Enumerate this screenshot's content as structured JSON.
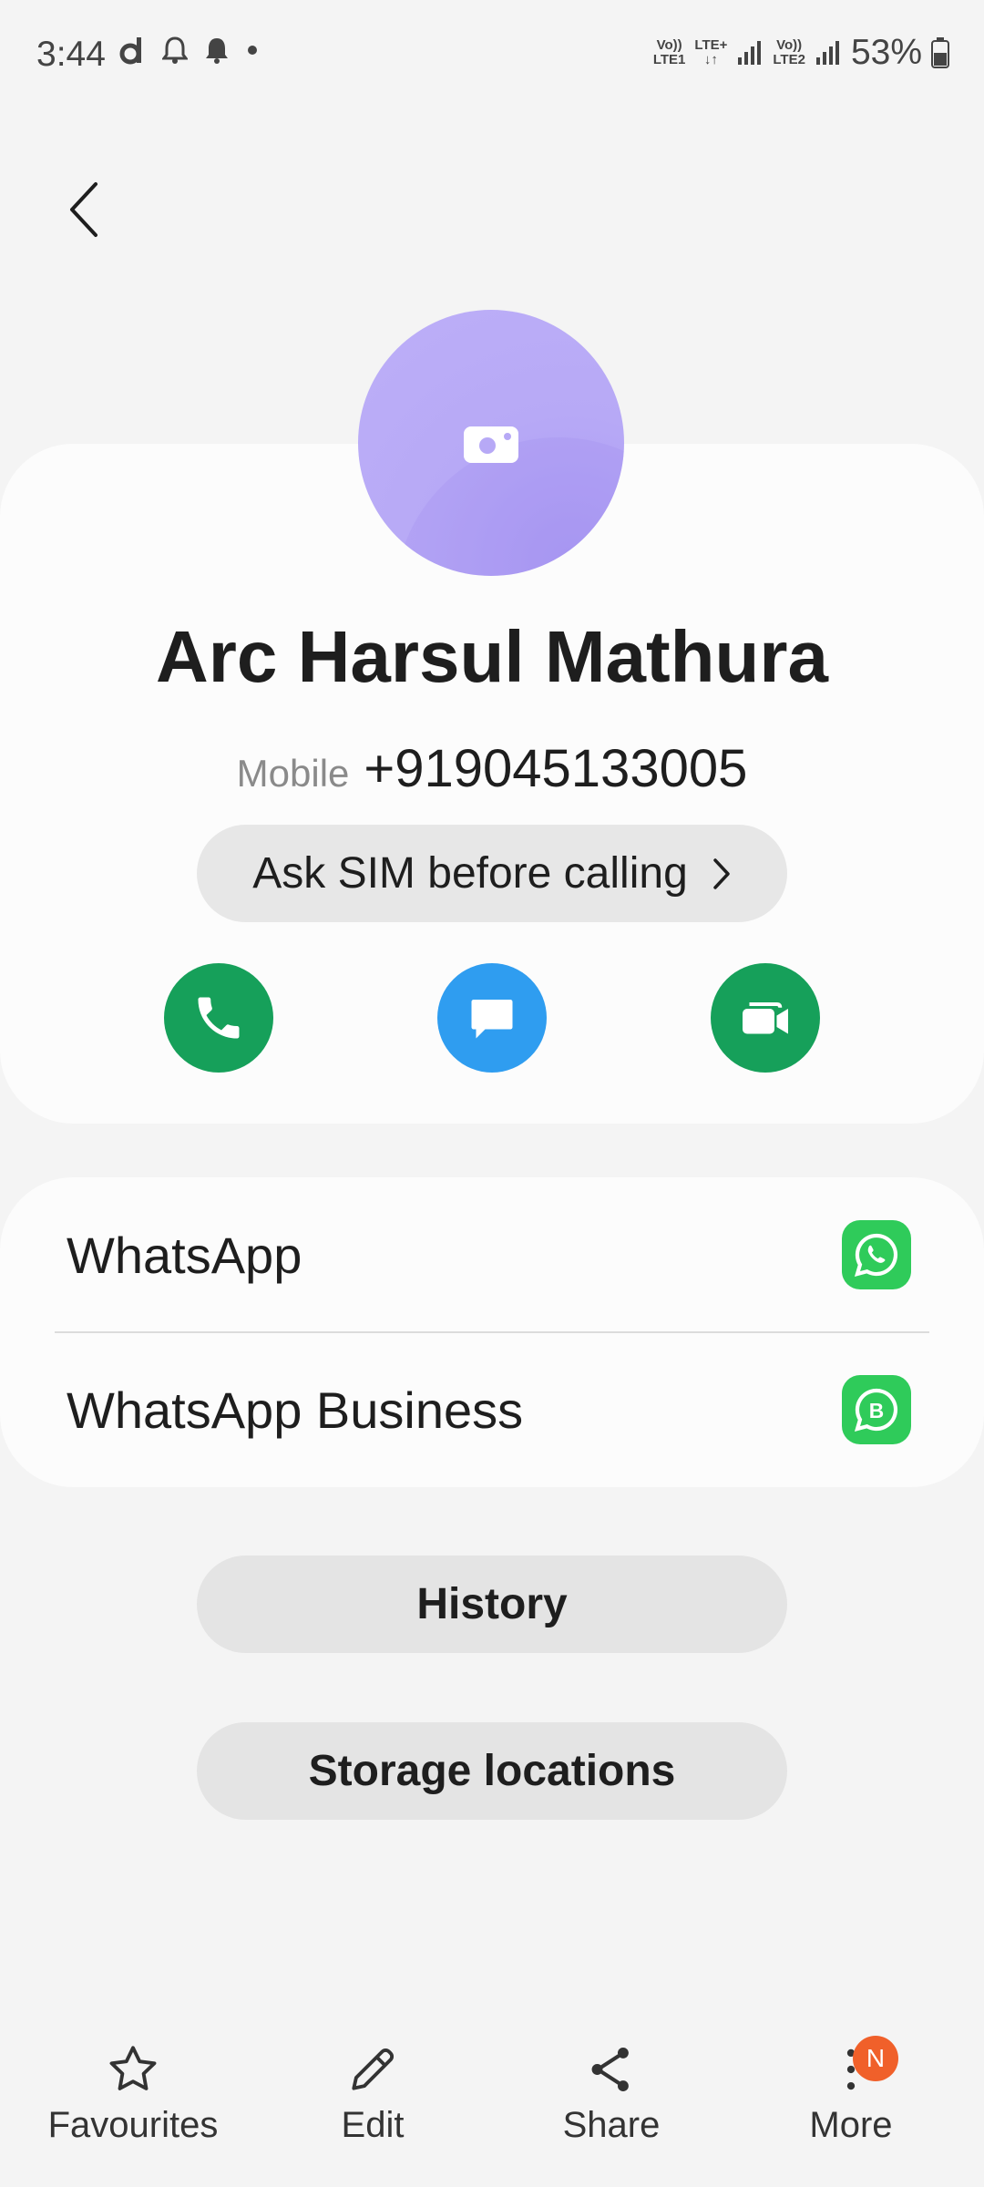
{
  "status_bar": {
    "time": "3:44",
    "battery": "53%",
    "net1_top": "Vo))",
    "net1_bottom": "LTE1",
    "net1b_top": "LTE+",
    "net1b_bottom": "↓↑",
    "net2_top": "Vo))",
    "net2_bottom": "LTE2"
  },
  "contact": {
    "name": "Arc Harsul Mathura",
    "phone_type": "Mobile",
    "phone_number": "+919045133005",
    "sim_option": "Ask SIM before calling",
    "avatar_color": "#b7a9f6"
  },
  "actions": {
    "call_color": "#16a05a",
    "message_color": "#2f9df0",
    "video_color": "#16a05a"
  },
  "apps": [
    {
      "label": "WhatsApp",
      "icon": "whatsapp-icon"
    },
    {
      "label": "WhatsApp Business",
      "icon": "whatsapp-business-icon"
    }
  ],
  "buttons": {
    "history": "History",
    "storage": "Storage locations"
  },
  "bottom_nav": {
    "favourites": "Favourites",
    "edit": "Edit",
    "share": "Share",
    "more": "More",
    "more_badge": "N"
  }
}
